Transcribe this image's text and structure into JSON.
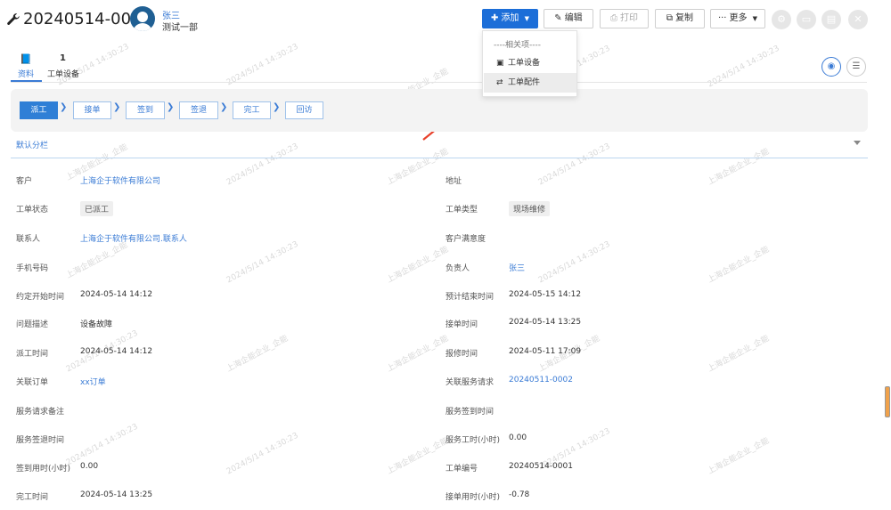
{
  "header": {
    "title": "20240514-0001",
    "user_name": "张三",
    "user_dept": "测试一部"
  },
  "toolbar": {
    "add": "添加",
    "edit": "编辑",
    "print": "打印",
    "copy": "复制",
    "more": "更多"
  },
  "dropdown": {
    "heading": "----相关项----",
    "items": [
      "工单设备",
      "工单配件"
    ]
  },
  "tabs": {
    "t1": "资料",
    "t2_count": "1",
    "t2": "工单设备"
  },
  "steps": [
    "派工",
    "接单",
    "签到",
    "签退",
    "完工",
    "回访"
  ],
  "section": "默认分栏",
  "fields": {
    "l1": "客户",
    "v1": "上海企于软件有限公司",
    "r1": "地址",
    "l2": "工单状态",
    "v2": "已派工",
    "r2": "工单类型",
    "rv2": "现场维修",
    "l3": "联系人",
    "v3": "上海企于软件有限公司.联系人",
    "r3": "客户满意度",
    "l4": "手机号码",
    "r4": "负责人",
    "rv4": "张三",
    "l5": "约定开始时间",
    "v5": "2024-05-14 14:12",
    "r5": "预计结束时间",
    "rv5": "2024-05-15 14:12",
    "l6": "问题描述",
    "v6": "设备故障",
    "r6": "接单时间",
    "rv6": "2024-05-14 13:25",
    "l7": "派工时间",
    "v7": "2024-05-14 14:12",
    "r7": "报修时间",
    "rv7": "2024-05-11 17:09",
    "l8": "关联订单",
    "v8": "xx订单",
    "r8": "关联服务请求",
    "rv8": "20240511-0002",
    "l9": "服务请求备注",
    "r9": "服务签到时间",
    "l10": "服务签退时间",
    "r10": "服务工时(小时)",
    "rv10": "0.00",
    "l11": "签到用时(小时)",
    "v11": "0.00",
    "r11": "工单编号",
    "rv11": "20240514-0001",
    "l12": "完工时间",
    "v12": "2024-05-14 13:25",
    "r12": "接单用时(小时)",
    "rv12": "-0.78"
  },
  "watermark": {
    "time": "2024/5/14 14:30:23",
    "company": "上海企能企业_企能"
  },
  "colors": {
    "accent": "#1c6ed8",
    "link": "#3a7bd5",
    "annotation": "#e8402a"
  }
}
